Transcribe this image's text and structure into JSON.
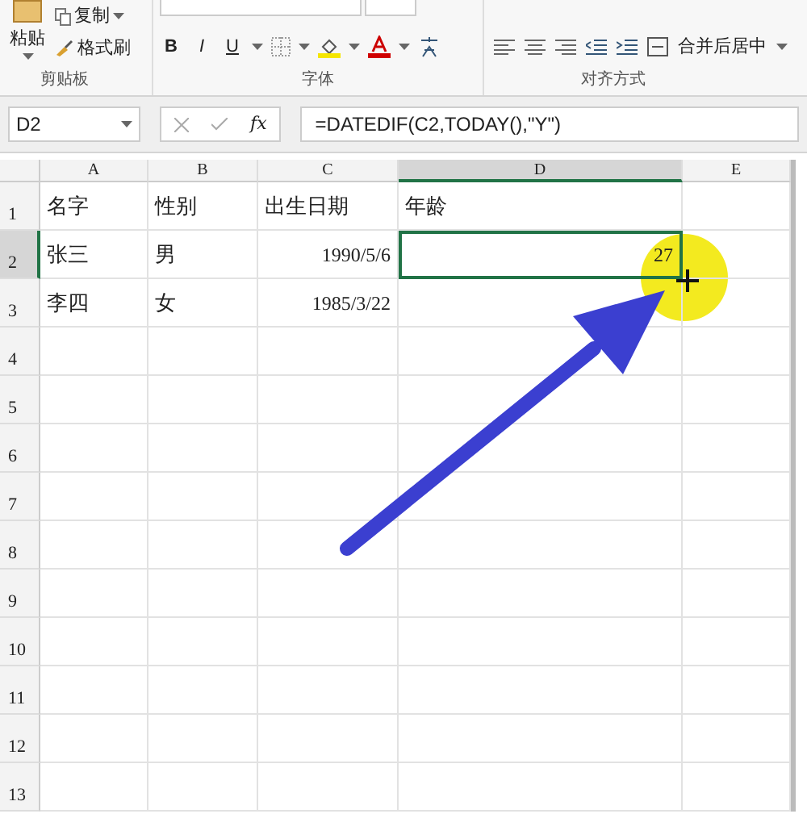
{
  "ribbon": {
    "clipboard": {
      "paste": "粘贴",
      "copy": "复制",
      "format_painter": "格式刷",
      "label": "剪贴板"
    },
    "font": {
      "bold": "B",
      "italic": "I",
      "underline": "U",
      "label": "字体"
    },
    "alignment": {
      "merge": "合并后居中",
      "label": "对齐方式"
    }
  },
  "formula_bar": {
    "name_box": "D2",
    "fx": "fx",
    "formula": "=DATEDIF(C2,TODAY(),\"Y\")"
  },
  "columns": [
    {
      "label": "A",
      "selected": false
    },
    {
      "label": "B",
      "selected": false
    },
    {
      "label": "C",
      "selected": false
    },
    {
      "label": "D",
      "selected": true
    },
    {
      "label": "E",
      "selected": false
    }
  ],
  "rows": [
    {
      "header": "1",
      "selected": false,
      "cells": [
        {
          "kind": "text",
          "value": "名字",
          "selected": false
        },
        {
          "kind": "text",
          "value": "性别",
          "selected": false
        },
        {
          "kind": "text",
          "value": "出生日期",
          "selected": false
        },
        {
          "kind": "text",
          "value": "年龄",
          "selected": false
        },
        {
          "kind": "empty",
          "selected": false
        }
      ]
    },
    {
      "header": "2",
      "selected": true,
      "cells": [
        {
          "kind": "text",
          "value": "张三",
          "selected": false
        },
        {
          "kind": "text",
          "value": "男",
          "selected": false
        },
        {
          "kind": "number",
          "value": "1990/5/6",
          "selected": false
        },
        {
          "kind": "number",
          "value": "27",
          "selected": true
        },
        {
          "kind": "empty",
          "selected": false
        }
      ]
    },
    {
      "header": "3",
      "selected": false,
      "cells": [
        {
          "kind": "text",
          "value": "李四",
          "selected": false
        },
        {
          "kind": "text",
          "value": "女",
          "selected": false
        },
        {
          "kind": "number",
          "value": "1985/3/22",
          "selected": false
        },
        {
          "kind": "empty",
          "selected": false
        },
        {
          "kind": "empty",
          "selected": false
        }
      ]
    },
    {
      "header": "4",
      "selected": false
    },
    {
      "header": "5",
      "selected": false
    },
    {
      "header": "6",
      "selected": false
    },
    {
      "header": "7",
      "selected": false
    },
    {
      "header": "8",
      "selected": false
    },
    {
      "header": "9",
      "selected": false
    },
    {
      "header": "10",
      "selected": false
    },
    {
      "header": "11",
      "selected": false
    },
    {
      "header": "12",
      "selected": false
    },
    {
      "header": "13",
      "selected": false
    }
  ]
}
